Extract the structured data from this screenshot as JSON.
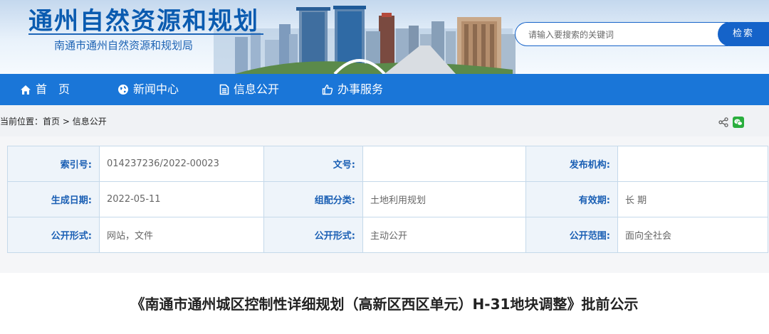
{
  "header": {
    "title": "通州自然资源和规划",
    "subtitle": "南通市通州自然资源和规划局",
    "search": {
      "placeholder": "请输入要搜索的关键词",
      "button_label": "检索"
    },
    "colors": {
      "brand": "#0a5bb0",
      "accent": "#1563c9"
    }
  },
  "nav": {
    "items": [
      {
        "label": "首　页",
        "icon": "home-icon"
      },
      {
        "label": "新闻中心",
        "icon": "globe-icon"
      },
      {
        "label": "信息公开",
        "icon": "document-icon"
      },
      {
        "label": "办事服务",
        "icon": "thumbs-up-icon"
      }
    ],
    "color": "#1a76d8"
  },
  "breadcrumb": {
    "prefix": "当前位置：",
    "items": [
      "首页",
      "信息公开"
    ],
    "separator": " > "
  },
  "toolbar": {
    "icons": [
      "share-icon",
      "wechat-icon"
    ]
  },
  "info_table": {
    "rows": [
      [
        {
          "label": "索引号:",
          "value": "014237236/2022-00023"
        },
        {
          "label": "文号:",
          "value": ""
        },
        {
          "label": "发布机构:",
          "value": ""
        }
      ],
      [
        {
          "label": "生成日期:",
          "value": "2022-05-11"
        },
        {
          "label": "组配分类:",
          "value": "土地利用规划"
        },
        {
          "label": "有效期:",
          "value": "长 期"
        }
      ],
      [
        {
          "label": "公开形式:",
          "value": "网站，文件"
        },
        {
          "label": "公开形式:",
          "value": "主动公开"
        },
        {
          "label": "公开范围:",
          "value": "面向全社会"
        }
      ]
    ]
  },
  "article": {
    "title": "《南通市通州城区控制性详细规划（高新区西区单元）H-31地块调整》批前公示"
  }
}
